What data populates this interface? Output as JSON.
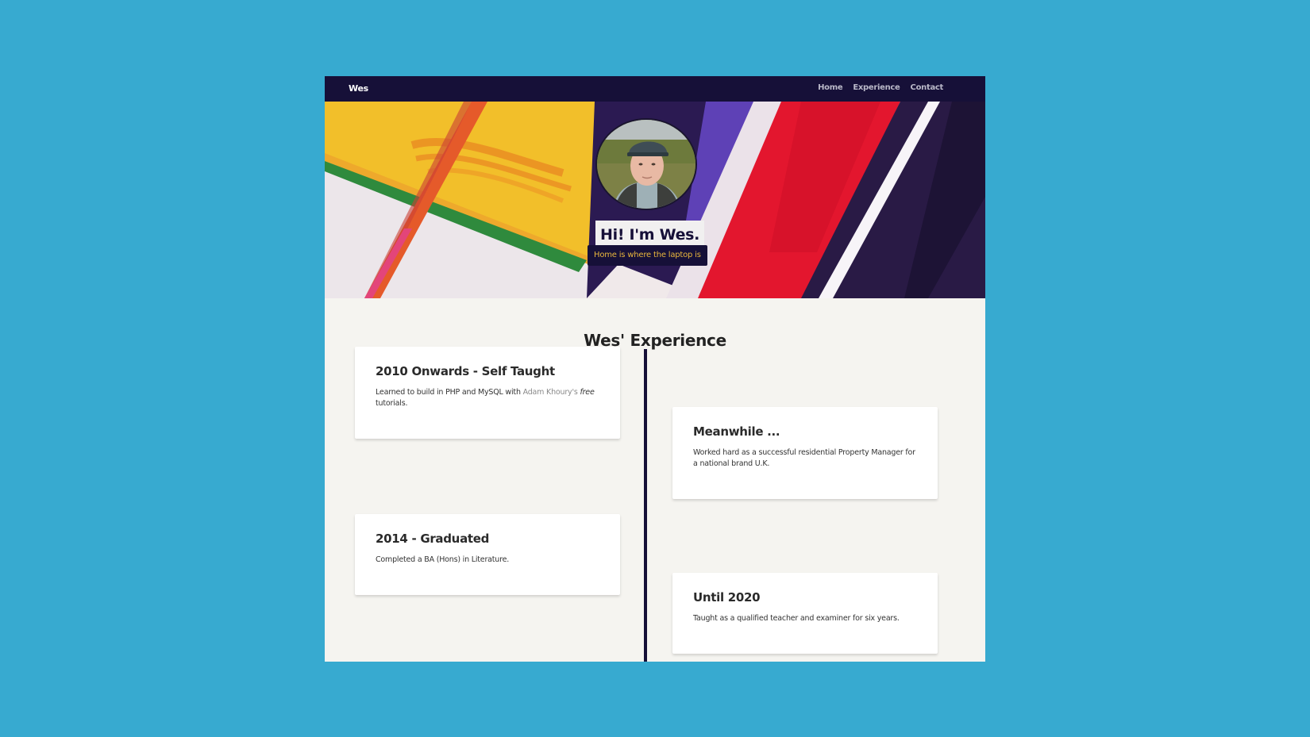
{
  "navbar": {
    "brand": "Wes",
    "links": [
      "Home",
      "Experience",
      "Contact"
    ]
  },
  "hero": {
    "title": "Hi! I'm Wes.",
    "tagline": "Home is where the laptop is"
  },
  "experience": {
    "title": "Wes' Experience",
    "cards": [
      {
        "title": "2010 Onwards - Self Taught",
        "text_before": "Learned to build in PHP and MySQL with ",
        "link_text": "Adam Khoury's",
        "text_mid": " ",
        "emphasis": "free",
        "text_after": " tutorials."
      },
      {
        "title": "Meanwhile ...",
        "text": "Worked hard as a successful residential Property Manager for a national brand U.K."
      },
      {
        "title": "2014 - Graduated",
        "text": "Completed a BA (Hons) in Literature."
      },
      {
        "title": "Until 2020",
        "text": "Taught as a qualified teacher and examiner for six years."
      }
    ]
  },
  "colors": {
    "page_background": "#37aad0",
    "navbar": "#161038",
    "tagline_text": "#e9b63d",
    "content_background": "#f5f4f0"
  }
}
